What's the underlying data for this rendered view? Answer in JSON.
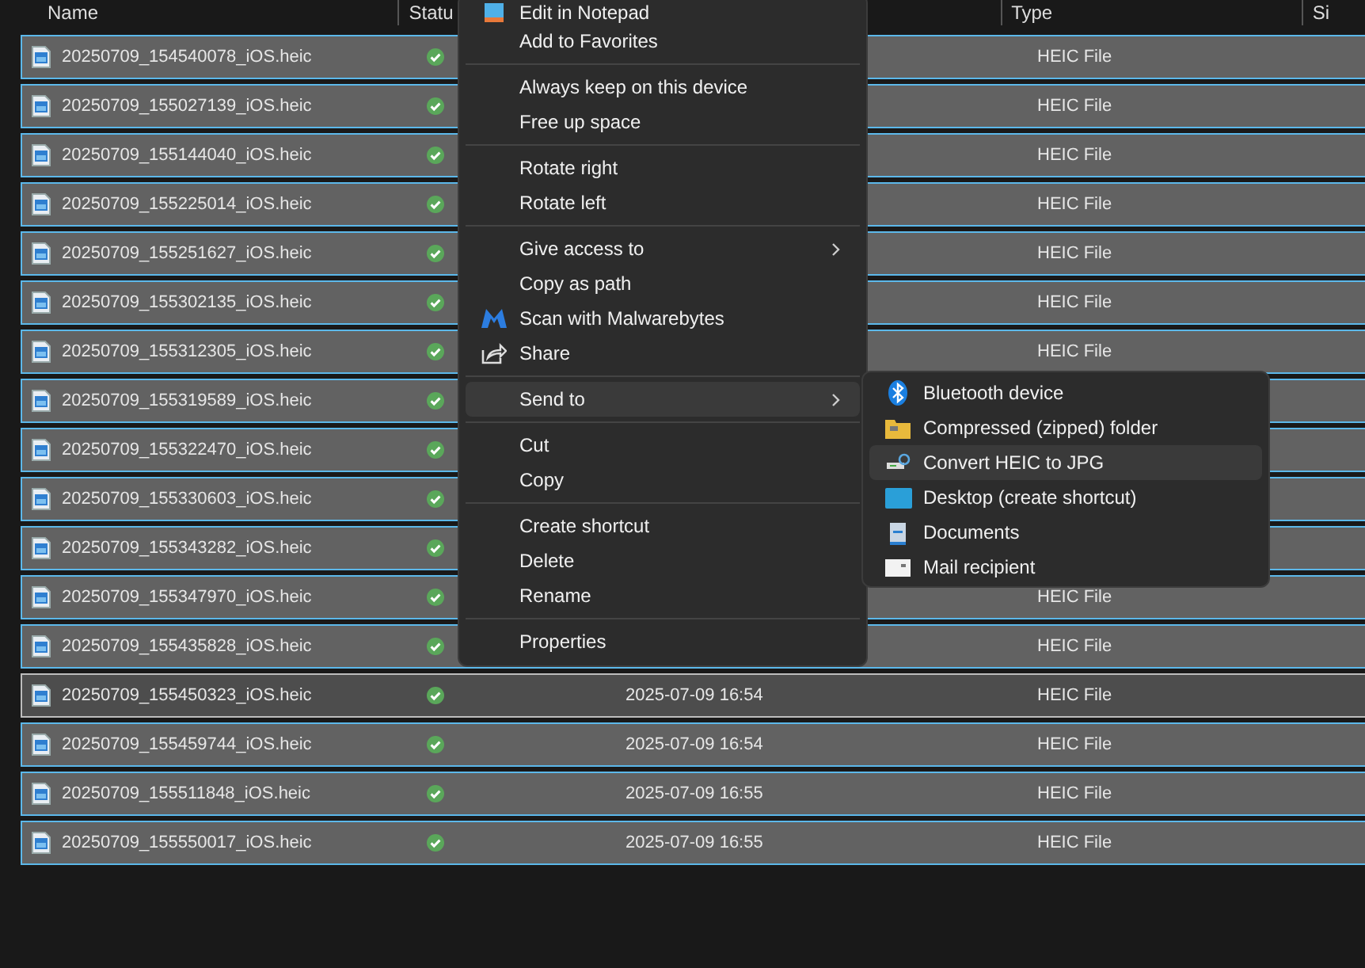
{
  "columns": [
    {
      "label": "Name"
    },
    {
      "label": "Statu"
    },
    {
      "label": "Type"
    },
    {
      "label": "Si"
    }
  ],
  "rows": [
    {
      "name": "20250709_154540078_iOS.heic",
      "selected": true,
      "focused": false,
      "type": "HEIC File"
    },
    {
      "name": "20250709_155027139_iOS.heic",
      "selected": true,
      "focused": false,
      "type": "HEIC File"
    },
    {
      "name": "20250709_155144040_iOS.heic",
      "selected": true,
      "focused": false,
      "type": "HEIC File"
    },
    {
      "name": "20250709_155225014_iOS.heic",
      "selected": true,
      "focused": false,
      "type": "HEIC File"
    },
    {
      "name": "20250709_155251627_iOS.heic",
      "selected": true,
      "focused": false,
      "type": "HEIC File"
    },
    {
      "name": "20250709_155302135_iOS.heic",
      "selected": true,
      "focused": false,
      "type": "HEIC File"
    },
    {
      "name": "20250709_155312305_iOS.heic",
      "selected": true,
      "focused": false,
      "type": "HEIC File"
    },
    {
      "name": "20250709_155319589_iOS.heic",
      "selected": true,
      "focused": false
    },
    {
      "name": "20250709_155322470_iOS.heic",
      "selected": true,
      "focused": false
    },
    {
      "name": "20250709_155330603_iOS.heic",
      "selected": true,
      "focused": false
    },
    {
      "name": "20250709_155343282_iOS.heic",
      "selected": true,
      "focused": false
    },
    {
      "name": "20250709_155347970_iOS.heic",
      "selected": true,
      "focused": false,
      "type": "HEIC File"
    },
    {
      "name": "20250709_155435828_iOS.heic",
      "selected": true,
      "focused": false,
      "type": "HEIC File"
    },
    {
      "name": "20250709_155450323_iOS.heic",
      "selected": true,
      "focused": true,
      "date": "2025-07-09 16:54",
      "type": "HEIC File"
    },
    {
      "name": "20250709_155459744_iOS.heic",
      "selected": true,
      "focused": false,
      "date": "2025-07-09 16:54",
      "type": "HEIC File"
    },
    {
      "name": "20250709_155511848_iOS.heic",
      "selected": true,
      "focused": false,
      "date": "2025-07-09 16:55",
      "type": "HEIC File"
    },
    {
      "name": "20250709_155550017_iOS.heic",
      "selected": true,
      "focused": false,
      "date": "2025-07-09 16:55",
      "type": "HEIC File"
    }
  ],
  "context_menu": {
    "groups": [
      [
        {
          "label": "Edit in Notepad",
          "submenu": false,
          "selected": false
        },
        {
          "label": "Add to Favorites",
          "submenu": false,
          "selected": false
        }
      ],
      [
        {
          "label": "Always keep on this device",
          "submenu": false,
          "selected": false
        },
        {
          "label": "Free up space",
          "submenu": false,
          "selected": false
        }
      ],
      [
        {
          "label": "Rotate right",
          "submenu": false,
          "selected": false
        },
        {
          "label": "Rotate left",
          "submenu": false,
          "selected": false
        }
      ],
      [
        {
          "label": "Give access to",
          "submenu": true,
          "selected": false
        },
        {
          "label": "Copy as path",
          "submenu": false,
          "selected": false
        },
        {
          "label": "Scan with Malwarebytes",
          "submenu": false,
          "selected": false
        },
        {
          "label": "Share",
          "submenu": false,
          "selected": false
        }
      ],
      [
        {
          "label": "Send to",
          "submenu": true,
          "selected": true
        }
      ],
      [
        {
          "label": "Cut",
          "submenu": false,
          "selected": false
        },
        {
          "label": "Copy",
          "submenu": false,
          "selected": false
        }
      ],
      [
        {
          "label": "Create shortcut",
          "submenu": false,
          "selected": false
        },
        {
          "label": "Delete",
          "submenu": false,
          "selected": false
        },
        {
          "label": "Rename",
          "submenu": false,
          "selected": false
        }
      ],
      [
        {
          "label": "Properties",
          "submenu": false,
          "selected": false
        }
      ]
    ]
  },
  "send_to_menu": {
    "items": [
      {
        "label": "Bluetooth device",
        "selected": false
      },
      {
        "label": "Compressed (zipped) folder",
        "selected": false
      },
      {
        "label": "Convert HEIC to JPG",
        "selected": true
      },
      {
        "label": "Desktop (create shortcut)",
        "selected": false
      },
      {
        "label": "Documents",
        "selected": false
      },
      {
        "label": "Mail recipient",
        "selected": false
      }
    ]
  }
}
